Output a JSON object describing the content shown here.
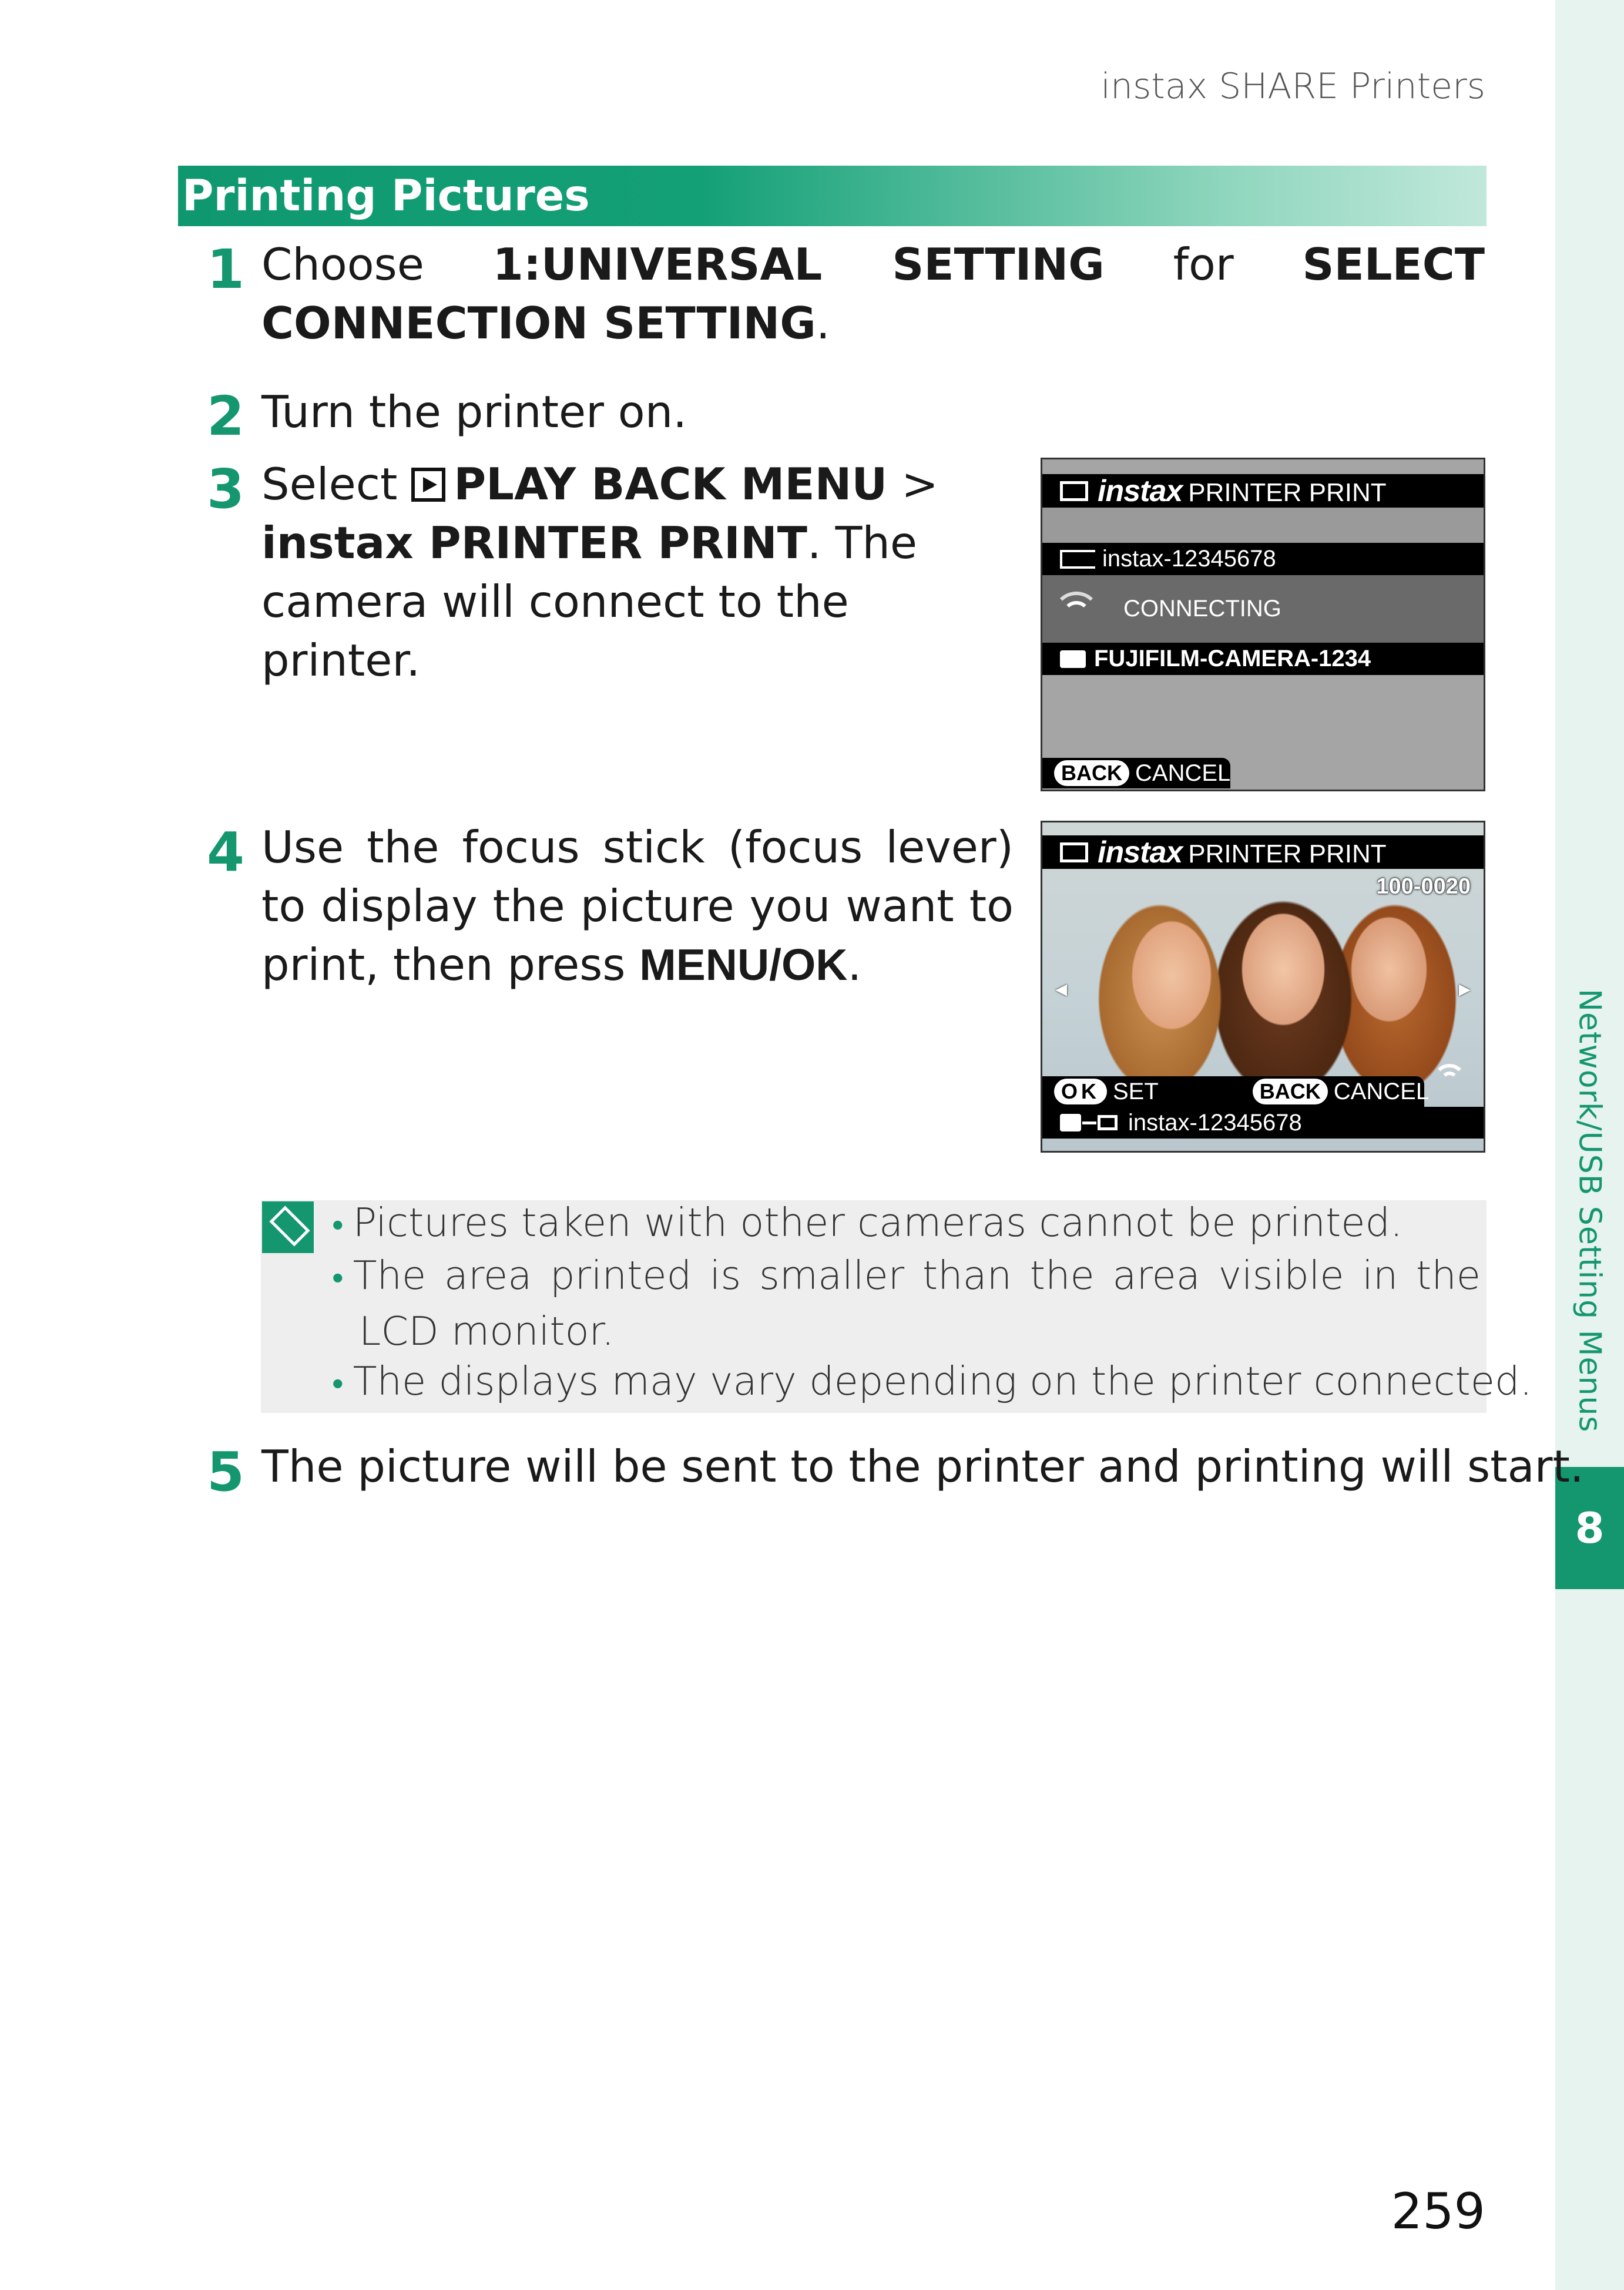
{
  "running_head": "instax SHARE Printers",
  "section_title": "Printing Pictures",
  "steps": [
    {
      "num": "1",
      "parts": {
        "a": "Choose ",
        "b": "1:UNIVERSAL SETTING",
        "c": " for ",
        "d": "SELECT CONNECTION SETTING",
        "e": "."
      }
    },
    {
      "num": "2",
      "text": "Turn the printer on."
    },
    {
      "num": "3",
      "parts": {
        "a": "Select ",
        "b": "PLAY BACK MENU",
        "c": " > ",
        "d": "instax PRINTER PRINT",
        "e": ". The camera will connect to the printer."
      }
    },
    {
      "num": "4",
      "parts": {
        "a": "Use the focus stick (focus lever) to display the picture you want to print, then press ",
        "b": "MENU/OK",
        "c": "."
      }
    },
    {
      "num": "5",
      "text": "The picture will be sent to the printer and printing will start."
    }
  ],
  "lcd1": {
    "brand": "instax",
    "title": "PRINTER PRINT",
    "printer_name": "instax-12345678",
    "status": "CONNECTING",
    "camera_name": "FUJIFILM-CAMERA-1234",
    "back_label": "BACK",
    "cancel_label": "CANCEL"
  },
  "lcd2": {
    "brand": "instax",
    "title": "PRINTER PRINT",
    "frame_number": "100-0020",
    "ok_label": "OK",
    "set_label": "SET",
    "back_label": "BACK",
    "cancel_label": "CANCEL",
    "printer_name": "instax-12345678"
  },
  "notes": [
    "Pictures taken with other cameras cannot be printed.",
    "The area printed is smaller than the area visible in the LCD monitor.",
    "The displays may vary depending on the printer connected."
  ],
  "side_tab": {
    "label": "Network/USB Setting Menus",
    "chapter": "8"
  },
  "page_number": "259",
  "colors": {
    "accent": "#14966e",
    "tab_background": "#e6f3ee",
    "note_background": "#eeeeee"
  }
}
